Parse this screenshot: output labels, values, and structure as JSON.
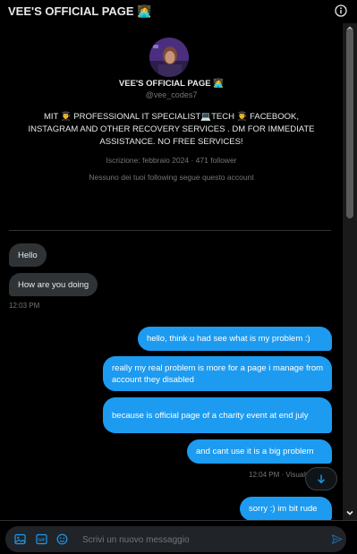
{
  "header": {
    "title": "VEE'S OFFICIAL PAGE 👩‍💻"
  },
  "profile": {
    "name": "VEE'S OFFICIAL PAGE 👩‍💻",
    "handle": "@vee_codes7",
    "bio": "MIT 👨‍🎓 PROFESSIONAL IT SPECIALIST💻TECH 👨‍🎓 FACEBOOK, INSTAGRAM AND OTHER RECOVERY SERVICES . DM FOR IMMEDIATE ASSISTANCE. NO FREE SERVICES!",
    "joined": "Iscrizione: febbraio 2024",
    "followers": "471 follower",
    "mutuals": "Nessuno dei tuoi following segue questo account"
  },
  "messages": {
    "in1": "Hello",
    "in2": "How are you doing",
    "in_time": "12:03 PM",
    "out1": "hello, think u had see what is my problem :)",
    "out2": "really my real problem is more for a page i manage from account they disabled",
    "out3": "because is official page of a charity event at end july",
    "out4": "and cant use it is a big problem",
    "out_time": "12:04 PM · Visualizzato",
    "out5": "sorry :) im bit rude"
  },
  "composer": {
    "placeholder": "Scrivi un nuovo messaggio"
  },
  "colors": {
    "accent": "#1d9bf0",
    "incoming_bubble": "#2f3336",
    "background": "#000000"
  }
}
